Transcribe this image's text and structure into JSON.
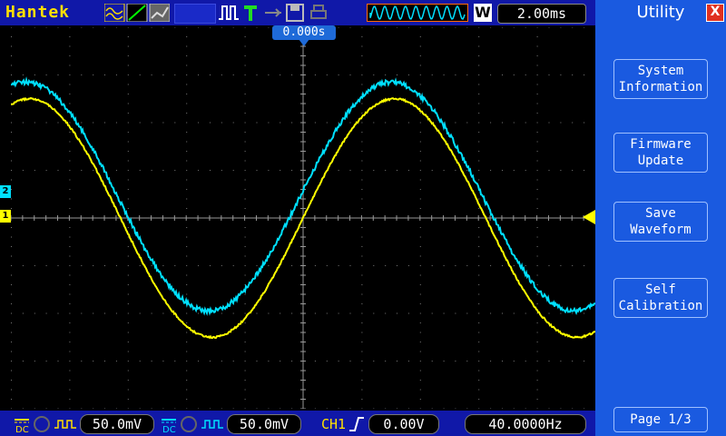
{
  "header": {
    "brand": "Hantek",
    "timebase": "2.00ms",
    "mode_badge": "W",
    "trigger_position": "0.000s",
    "icons": [
      "waveform-icon",
      "cursor-icon",
      "display-icon",
      "pulse-icon",
      "trigger-t-icon",
      "usb-icon",
      "save-icon",
      "print-icon"
    ]
  },
  "sidebar": {
    "title": "Utility",
    "close_label": "X",
    "buttons": [
      {
        "line1": "System",
        "line2": "Information"
      },
      {
        "line1": "Firmware",
        "line2": "Update"
      },
      {
        "line1": "Save",
        "line2": "Waveform"
      },
      {
        "line1": "Self",
        "line2": "Calibration"
      }
    ],
    "page_label": "Page 1/3"
  },
  "footer": {
    "ch1_coupling": "DC",
    "ch1_scale": "50.0mV",
    "ch2_coupling": "DC",
    "ch2_scale": "50.0mV",
    "trigger_source": "CH1",
    "trigger_level": "0.00V",
    "frequency": "40.0000Hz"
  },
  "markers": {
    "ch1": "1",
    "ch2": "2"
  },
  "colors": {
    "ch1": "#ffff00",
    "ch2": "#00e0ff",
    "bar": "#1018a8",
    "menu": "#1a5ae0"
  },
  "chart_data": {
    "type": "line",
    "x_divisions": 10,
    "y_divisions": 8,
    "series": [
      {
        "color": "#ffff00",
        "amplitude_div": 2.5,
        "period_div": 6.25,
        "phase_div": 5.0,
        "offset_div": 0
      },
      {
        "color": "#00e0ff",
        "amplitude_div": 2.4,
        "period_div": 6.25,
        "phase_div": 4.95,
        "offset_div": 0.45
      }
    ]
  }
}
